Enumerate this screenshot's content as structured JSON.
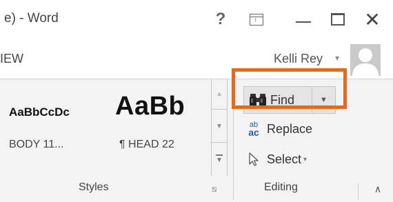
{
  "window": {
    "title": "e) - Word",
    "help_label": "?",
    "close_glyph": "✕"
  },
  "tabs": {
    "partial_tab": "IEW"
  },
  "user": {
    "name": "Kelli Rey",
    "caret": "▾"
  },
  "styles_group": {
    "items": [
      {
        "preview": "AaBbCcDc",
        "name": "BODY 11..."
      },
      {
        "preview": "AaBb",
        "name": "¶ HEAD 22"
      }
    ],
    "label": "Styles",
    "scroll_up": "▲",
    "scroll_down": "▼",
    "launcher": "⧅"
  },
  "editing_group": {
    "find_label": "Find",
    "find_caret": "▼",
    "replace_icon_top": "ab",
    "replace_icon_bottom": "ac",
    "replace_label": "Replace",
    "select_label": "Select",
    "select_caret": "▾",
    "label": "Editing",
    "collapse_glyph": "∧"
  },
  "colors": {
    "highlight": "#e46b1d",
    "ribbon_bg": "#f3f3f3",
    "find_bg": "#e4e4e4",
    "replace_icon": "#2a5b9c"
  },
  "icons": {
    "find": "binoculars-icon",
    "replace": "replace-icon",
    "select": "cursor-arrow-icon",
    "avatar": "user-avatar-icon"
  }
}
